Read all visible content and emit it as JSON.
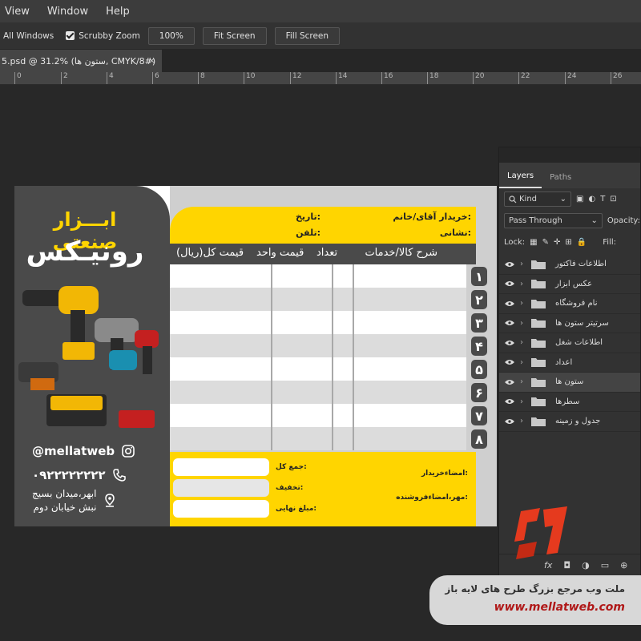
{
  "menu": [
    "View",
    "Window",
    "Help"
  ],
  "options": {
    "all_windows": "All Windows",
    "scrubby_zoom": "Scrubby Zoom",
    "zoom_value": "100%",
    "fit_screen": "Fit Screen",
    "fill_screen": "Fill Screen"
  },
  "doc_tab": {
    "title": "5.psd @ 31.2% (ستون ها, CMYK/8#)",
    "close": "×"
  },
  "ruler": [
    "0",
    "2",
    "4",
    "6",
    "8",
    "10",
    "12",
    "14",
    "16",
    "18",
    "20",
    "22",
    "24",
    "26"
  ],
  "card": {
    "brand_top": "ابـــزار صنعتی",
    "brand_main": "رونیـکس",
    "instagram": "@mellatweb",
    "phone": "۰۹۲۲۲۲۲۲۲۲",
    "address_line1": "ابهر،میدان بسیج",
    "address_line2": "نبش خیابان دوم",
    "buyer": "خریدار آقای/خانم:",
    "date": "تاریخ:",
    "address": "نشانی:",
    "tel": "تلفن:",
    "col_desc": "شرح کالا/خدمات",
    "col_qty": "تعداد",
    "col_unit": "قیمت واحد",
    "col_total": "قیمت کل(ریال)",
    "row_numbers": [
      "۱",
      "۲",
      "۳",
      "۴",
      "۵",
      "۶",
      "۷",
      "۸"
    ],
    "sum": "جمع کل:",
    "discount": "تخفیف:",
    "final": "مبلغ نهایی:",
    "buyer_sign": "امضاءخریدار:",
    "seller_sign": "مهر،امضاءفروشنده:"
  },
  "layers_panel": {
    "tabs": [
      "Layers",
      "Paths"
    ],
    "kind": "Kind",
    "blend": "Pass Through",
    "opacity_label": "Opacity:",
    "lock_label": "Lock:",
    "fill_label": "Fill:",
    "layers": [
      "اطلاعات فاکتور",
      "عکس ابزار",
      "نام فروشگاه",
      "سرتیتر ستون ها",
      "اطلاعات شغل",
      "اعداد",
      "ستون ها",
      "سطرها",
      "جدول و زمینه"
    ],
    "selected_index": 6,
    "fx": "fx"
  },
  "watermark": {
    "line1": "ملت وب مرجع بزرگ طرح های لایه باز",
    "line2": "www.mellatweb.com"
  },
  "colors": {
    "yellow": "#ffd500",
    "dark_panel": "#4a4a4a",
    "logo_red": "#e53a1e"
  }
}
